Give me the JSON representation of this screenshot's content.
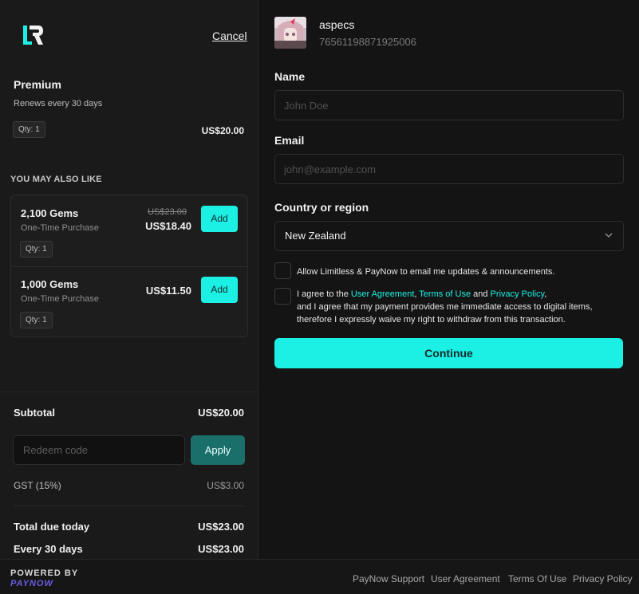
{
  "header": {
    "cancel_label": "Cancel"
  },
  "product": {
    "name": "Premium",
    "subtitle": "Renews every 30 days",
    "qty": "Qty: 1",
    "price": "US$20.00"
  },
  "upsell": {
    "heading": "YOU MAY ALSO LIKE",
    "items": [
      {
        "name": "2,100 Gems",
        "subtitle": "One-Time Purchase",
        "old_price": "US$23.00",
        "price": "US$18.40",
        "qty": "Qty: 1",
        "add_label": "Add"
      },
      {
        "name": "1,000 Gems",
        "subtitle": "One-Time Purchase",
        "old_price": "",
        "price": "US$11.50",
        "qty": "Qty: 1",
        "add_label": "Add"
      }
    ]
  },
  "summary": {
    "subtotal_label": "Subtotal",
    "subtotal_value": "US$20.00",
    "redeem_placeholder": "Redeem code",
    "apply_label": "Apply",
    "gst_label": "GST (15%)",
    "gst_value": "US$3.00",
    "total_label": "Total due today",
    "total_value": "US$23.00",
    "recurring_label": "Every 30 days",
    "recurring_value": "US$23.00"
  },
  "user": {
    "name": "aspecs",
    "id": "76561198871925006"
  },
  "form": {
    "name_label": "Name",
    "name_placeholder": "John Doe",
    "email_label": "Email",
    "email_placeholder": "john@example.com",
    "country_label": "Country or region",
    "country_value": "New Zealand",
    "updates_text": "Allow Limitless & PayNow to email me updates & announcements.",
    "agree_prefix": "I agree to the ",
    "agree_link1": "User Agreement",
    "agree_sep1": ", ",
    "agree_link2": "Terms of Use",
    "agree_sep2": " and ",
    "agree_link3": "Privacy Policy",
    "agree_suffix": ",",
    "agree_line2": "and I agree that my payment provides me immediate access to digital items,",
    "agree_line3": "therefore I expressly waive my right to withdraw from this transaction.",
    "continue_label": "Continue"
  },
  "footer": {
    "powered_by": "POWERED BY",
    "brand": "PAYNOW",
    "links": [
      "PayNow Support",
      "User Agreement",
      "Terms Of Use",
      "Privacy Policy"
    ]
  },
  "colors": {
    "accent": "#1cefe3",
    "apply_bg": "#1b6f6b",
    "brand_purple": "#6b5ce7",
    "background": "#141414",
    "panel": "#1a1a1a"
  },
  "icons": {
    "logo": "limitless-logo-icon",
    "chevron": "chevron-down-icon",
    "avatar": "user-avatar"
  }
}
